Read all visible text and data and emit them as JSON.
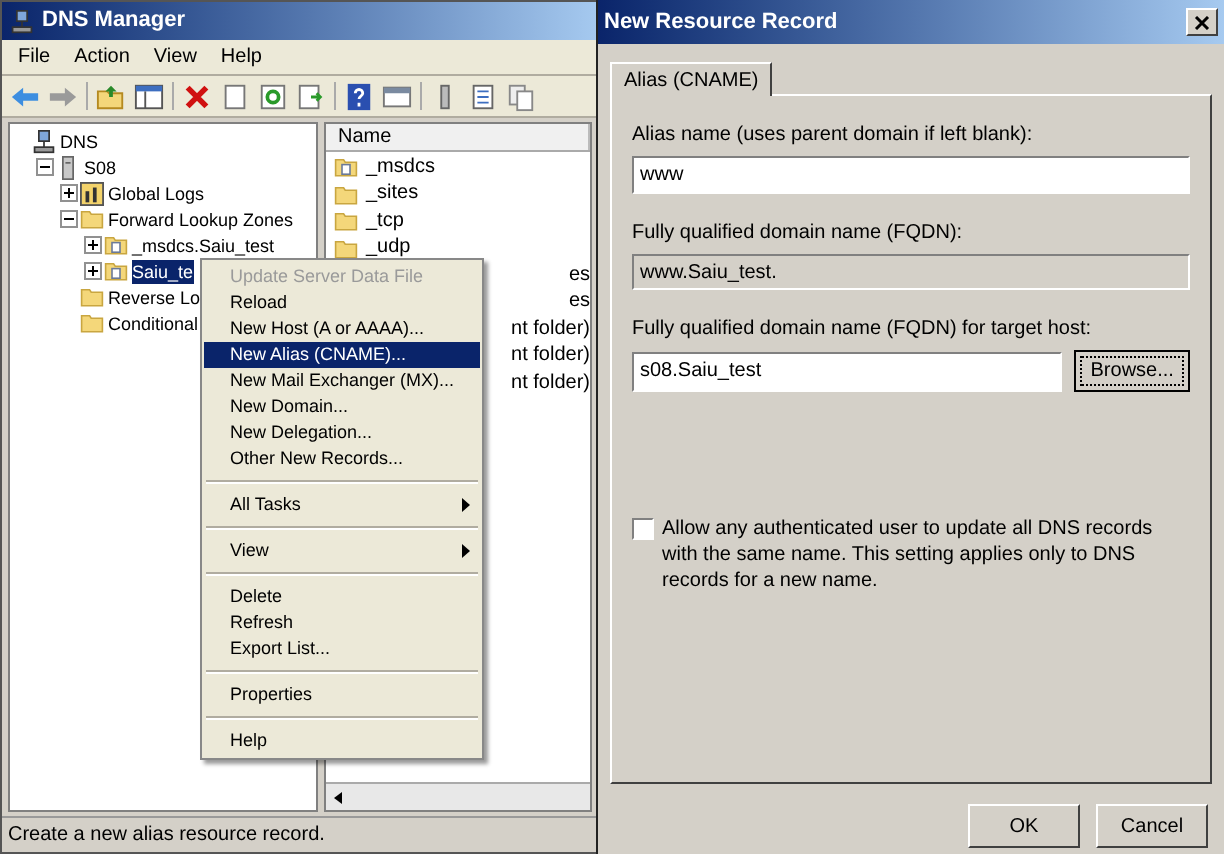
{
  "main_window": {
    "title": "DNS Manager",
    "menu": [
      "File",
      "Action",
      "View",
      "Help"
    ],
    "tree": [
      {
        "label": "DNS",
        "kind": "dns",
        "selected": false,
        "children": [
          {
            "label": "S08",
            "kind": "server",
            "expanded": true,
            "selected": false,
            "children": [
              {
                "label": "Global Logs",
                "kind": "log",
                "expanded": false,
                "selected": false
              },
              {
                "label": "Forward Lookup Zones",
                "kind": "folder",
                "expanded": true,
                "selected": false,
                "children": [
                  {
                    "label": "_msdcs.Saiu_test",
                    "kind": "zone",
                    "expanded": false,
                    "selected": false
                  },
                  {
                    "label": "Saiu_te",
                    "kind": "zone",
                    "expanded": false,
                    "selected": true
                  }
                ]
              },
              {
                "label": "Reverse Lo",
                "kind": "folder",
                "selected": false
              },
              {
                "label": "Conditional",
                "kind": "folder",
                "selected": false
              }
            ]
          }
        ]
      }
    ],
    "list": {
      "columns": [
        "Name"
      ],
      "rows": [
        {
          "kind": "zone",
          "name": "_msdcs"
        },
        {
          "kind": "folder",
          "name": "_sites"
        },
        {
          "kind": "folder",
          "name": "_tcp"
        },
        {
          "kind": "folder",
          "name": "_udp"
        },
        {
          "kind": "fragment",
          "name": "es"
        },
        {
          "kind": "fragment",
          "name": "es"
        },
        {
          "kind": "fragment",
          "name": "nt folder)"
        },
        {
          "kind": "fragment",
          "name": "nt folder)"
        },
        {
          "kind": "fragment",
          "name": "nt folder)"
        }
      ]
    },
    "context_menu": [
      {
        "kind": "item",
        "label": "Update Server Data File",
        "disabled": true,
        "selected": false
      },
      {
        "kind": "item",
        "label": "Reload",
        "disabled": false,
        "selected": false
      },
      {
        "kind": "item",
        "label": "New Host (A or AAAA)...",
        "disabled": false,
        "selected": false
      },
      {
        "kind": "item",
        "label": "New Alias (CNAME)...",
        "disabled": false,
        "selected": true
      },
      {
        "kind": "item",
        "label": "New Mail Exchanger (MX)...",
        "disabled": false,
        "selected": false
      },
      {
        "kind": "item",
        "label": "New Domain...",
        "disabled": false,
        "selected": false
      },
      {
        "kind": "item",
        "label": "New Delegation...",
        "disabled": false,
        "selected": false
      },
      {
        "kind": "item",
        "label": "Other New Records...",
        "disabled": false,
        "selected": false
      },
      {
        "kind": "separator"
      },
      {
        "kind": "submenu",
        "label": "All Tasks",
        "disabled": false,
        "selected": false
      },
      {
        "kind": "separator"
      },
      {
        "kind": "submenu",
        "label": "View",
        "disabled": false,
        "selected": false
      },
      {
        "kind": "separator"
      },
      {
        "kind": "item",
        "label": "Delete",
        "disabled": false,
        "selected": false
      },
      {
        "kind": "item",
        "label": "Refresh",
        "disabled": false,
        "selected": false
      },
      {
        "kind": "item",
        "label": "Export List...",
        "disabled": false,
        "selected": false
      },
      {
        "kind": "separator"
      },
      {
        "kind": "item",
        "label": "Properties",
        "disabled": false,
        "selected": false
      },
      {
        "kind": "separator"
      },
      {
        "kind": "item",
        "label": "Help",
        "disabled": false,
        "selected": false
      }
    ],
    "status_bar": "Create a new alias resource record."
  },
  "dialog": {
    "title": "New Resource Record",
    "tabs": [
      {
        "label": "Alias (CNAME)",
        "selected": true
      }
    ],
    "alias_label": "Alias name (uses parent domain if left blank):",
    "alias_value": "www",
    "fqdn_label": "Fully qualified domain name (FQDN):",
    "fqdn_value": "www.Saiu_test.",
    "target_label": "Fully qualified domain name (FQDN) for target host:",
    "target_value": "s08.Saiu_test",
    "browse_button": "Browse...",
    "allow_update": {
      "label": "Allow any authenticated user to update all DNS records with the same name. This setting applies only to DNS records for a new name.",
      "checked": false
    },
    "buttons": [
      "OK",
      "Cancel"
    ]
  }
}
